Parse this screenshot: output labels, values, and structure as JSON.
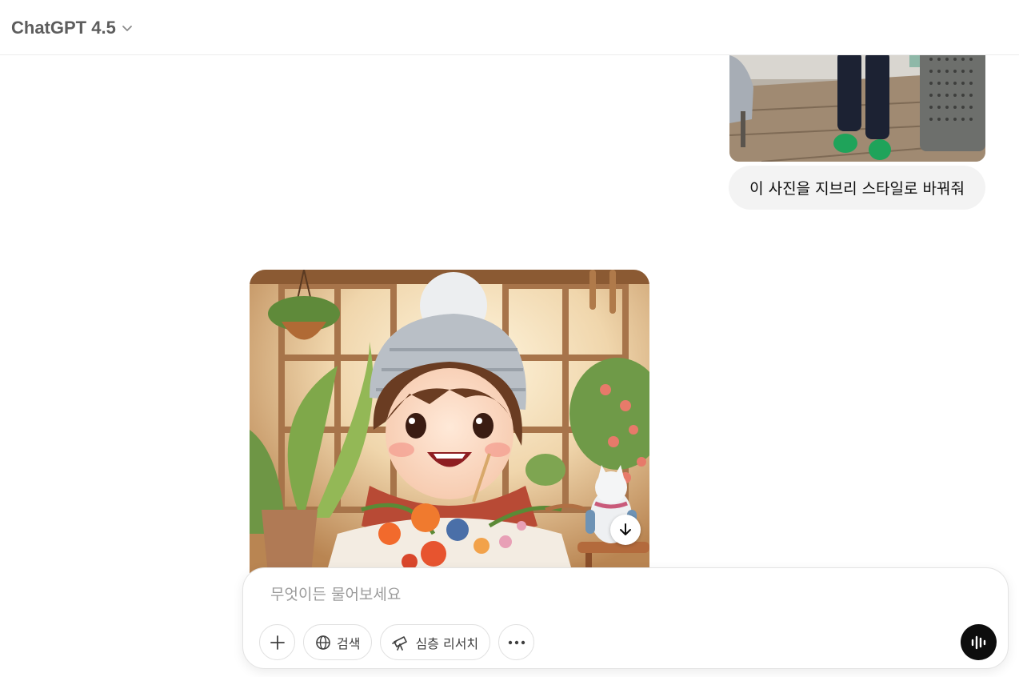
{
  "header": {
    "model_label": "ChatGPT 4.5"
  },
  "messages": {
    "user_text": "이 사진을 지브리 스타일로 바꿔줘"
  },
  "composer": {
    "placeholder": "무엇이든 물어보세요",
    "search_label": "검색",
    "deep_research_label": "심층 리서치"
  },
  "icons": {
    "model_chevron": "chevron-down-icon",
    "add": "plus-icon",
    "search": "globe-icon",
    "deep_research": "telescope-icon",
    "more": "ellipsis-icon",
    "voice": "voice-waveform-icon",
    "download": "arrow-down-icon"
  },
  "colors": {
    "accent_dark": "#0d0d0d",
    "bubble_bg": "#f3f3f3",
    "border": "#e3e3e3"
  }
}
